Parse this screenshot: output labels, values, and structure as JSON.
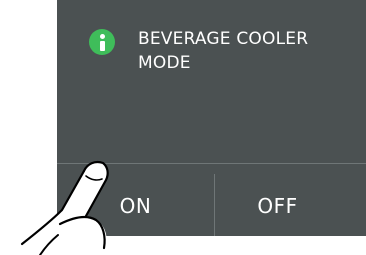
{
  "dialog": {
    "title": "BEVERAGE COOLER MODE",
    "icon": "info-icon",
    "buttons": {
      "on_label": "ON",
      "off_label": "OFF"
    }
  },
  "colors": {
    "panel_background": "#4b5152",
    "icon_accent": "#3fbd5a",
    "text": "#ffffff",
    "divider": "#6f7677"
  }
}
